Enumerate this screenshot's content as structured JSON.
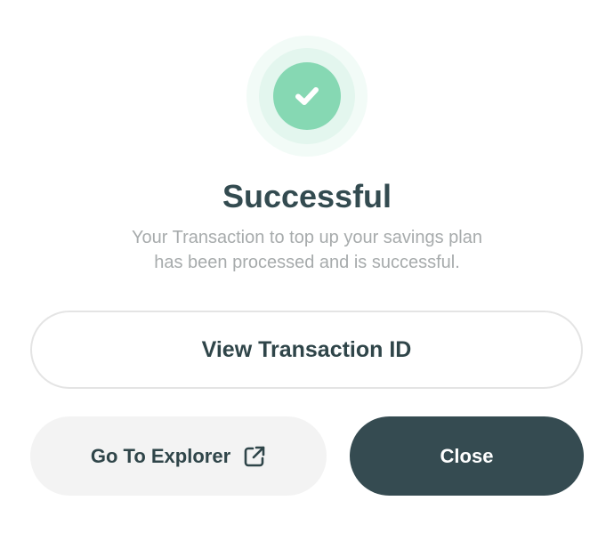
{
  "dialog": {
    "status_icon": "check-circle-icon",
    "title": "Successful",
    "message_line1": "Your Transaction to top up your savings plan",
    "message_line2": "has been processed and is successful."
  },
  "buttons": {
    "view_transaction_label": "View Transaction ID",
    "explorer_label": "Go To Explorer",
    "explorer_icon": "external-link-icon",
    "close_label": "Close"
  },
  "colors": {
    "success_green": "#86d8b3",
    "success_halo": "#e3f6ee",
    "heading": "#334b50",
    "muted_text": "#a7abac",
    "primary_button": "#354b51",
    "secondary_button": "#f3f3f3"
  }
}
